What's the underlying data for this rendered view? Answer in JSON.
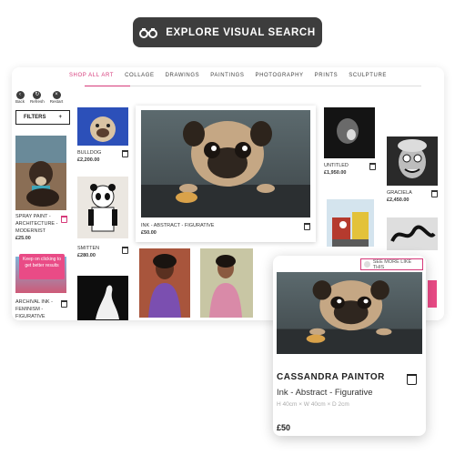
{
  "banner": {
    "label": "EXPLORE VISUAL SEARCH",
    "icon": "binoculars-icon"
  },
  "nav": {
    "items": [
      "SHOP ALL ART",
      "COLLAGE",
      "DRAWINGS",
      "PAINTINGS",
      "PHOTOGRAPHY",
      "PRINTS",
      "SCULPTURE"
    ],
    "active": "SHOP ALL ART"
  },
  "controls": {
    "back": "Back",
    "refresh": "Refresh",
    "restart": "Restart"
  },
  "filters": {
    "label": "FILTERS",
    "icon": "+"
  },
  "products": [
    {
      "title": "SPRAY PAINT - ARCHITECTURE - MODERNIST",
      "price": "£25.00"
    },
    {
      "title": "BULLDOG",
      "price": "£2,200.00"
    },
    {
      "title": "SMITTEN",
      "price": "£280.00"
    },
    {
      "title": "INK - ABSTRACT - FIGURATIVE",
      "price": "£50.00"
    },
    {
      "title": "UNTITLED",
      "price": "£1,950.00"
    },
    {
      "title": "GRACIELA",
      "price": "£2,450.00"
    },
    {
      "title": "ARCHIVAL INK - FEMINISM - FIGURATIVE",
      "price": ""
    }
  ],
  "tooltip": "Keep on clicking to get better results",
  "see_more": "SEE MORE LIKE THIS",
  "detail": {
    "artist": "CASSANDRA PAINTOR",
    "medium": "Ink - Abstract - Figurative",
    "dimensions": "H 40cm × W 40cm × D 2cm",
    "price": "£50"
  },
  "colors": {
    "accent": "#d63a7a",
    "banner": "#3d3d3d",
    "tooltip": "#e94b86"
  }
}
